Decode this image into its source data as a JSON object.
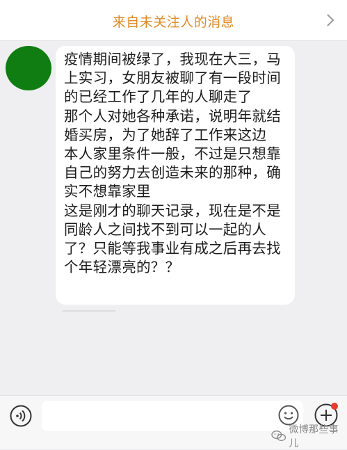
{
  "header": {
    "title": "来自未关注人的消息",
    "chevron_icon": "chevron-right-icon"
  },
  "conversation": {
    "message_lines": [
      "疫情期间被绿了，我现在大三，马",
      "上实习，女朋友被聊了有一段时间",
      "的已经工作了几年的人聊走了",
      "那个人对她各种承诺，说明年就结",
      "婚买房，为了她辞了工作来这边",
      "本人家里条件一般，不过是只想靠",
      "自己的努力去创造未来的那种，确",
      "实不想靠家里",
      "这是刚才的聊天记录，现在是不是",
      "同龄人之间找不到可以一起的人",
      "了？只能等我事业有成之后再去找",
      "个年轻漂亮的？？"
    ]
  },
  "input_bar": {
    "voice_icon": "voice-icon",
    "emoji_icon": "emoji-icon",
    "plus_icon": "plus-icon",
    "input_value": ""
  },
  "watermark": {
    "text": "微博那些事儿",
    "icon": "wechat-icon"
  },
  "colors": {
    "accent": "#e08a23",
    "avatar": "#0f7d12",
    "background": "#efeff1",
    "notify": "#e8392a"
  }
}
